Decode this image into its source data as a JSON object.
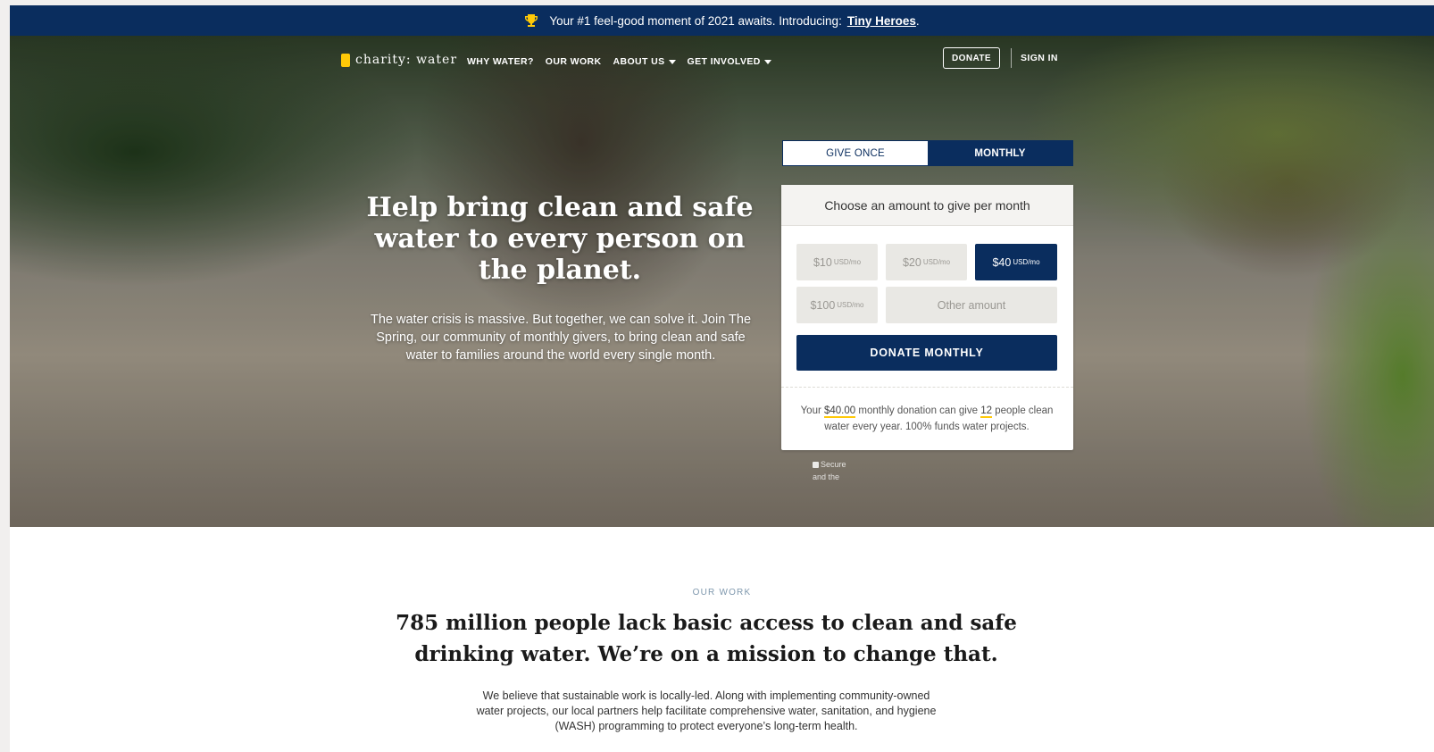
{
  "announcement": {
    "text": "Your #1 feel-good moment of 2021 awaits. Introducing:",
    "link": "Tiny Heroes",
    "suffix": "."
  },
  "nav": {
    "logo": "charity: water",
    "items": [
      {
        "label": "WHY WATER?",
        "dropdown": false
      },
      {
        "label": "OUR WORK",
        "dropdown": false
      },
      {
        "label": "ABOUT US",
        "dropdown": true
      },
      {
        "label": "GET INVOLVED",
        "dropdown": true
      }
    ],
    "donate": "DONATE",
    "signin": "SIGN IN"
  },
  "hero": {
    "title": "Help bring clean and safe water to every person on the planet.",
    "subtitle": "The water crisis is massive. But together, we can solve it. Join The Spring, our community of monthly givers, to bring clean and safe water to families around the world every single month."
  },
  "donation": {
    "tabs": [
      "GIVE ONCE",
      "MONTHLY"
    ],
    "active_tab": "MONTHLY",
    "heading": "Choose an amount to give per month",
    "amounts": [
      {
        "value": "$10",
        "unit": "USD/mo",
        "selected": false
      },
      {
        "value": "$20",
        "unit": "USD/mo",
        "selected": false
      },
      {
        "value": "$40",
        "unit": "USD/mo",
        "selected": true
      },
      {
        "value": "$100",
        "unit": "USD/mo",
        "selected": false
      }
    ],
    "other_placeholder": "Other amount",
    "button": "DONATE MONTHLY",
    "impact": {
      "pre": "Your ",
      "amount": "$40.00",
      "mid": " monthly donation can give ",
      "people": "12",
      "post": " people clean water every year. 100% funds water projects."
    },
    "secure_line1": "Secure",
    "secure_line2": "and the"
  },
  "our_work": {
    "eyebrow": "OUR WORK",
    "title": "785 million people lack basic access to clean and safe drinking water. We’re on a mission to change that.",
    "body": "We believe that sustainable work is locally-led. Along with implementing community-owned water projects, our local partners help facilitate comprehensive water, sanitation, and hygiene (WASH) programming to protect everyone’s long-term health."
  },
  "colors": {
    "navy": "#0a2d5e",
    "yellow": "#ffc907"
  }
}
